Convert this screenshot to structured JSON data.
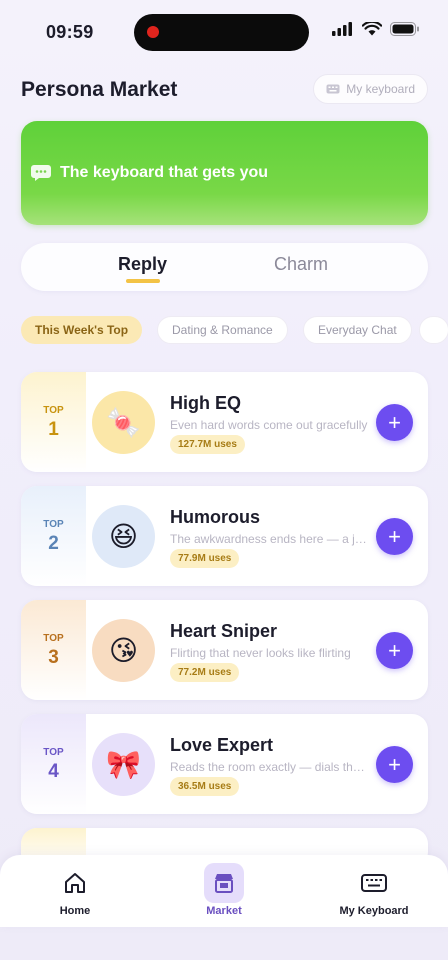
{
  "status_bar": {
    "time": "09:59"
  },
  "header": {
    "title": "Persona Market",
    "my_keyboard_label": "My keyboard"
  },
  "banner": {
    "text": "The keyboard that gets you"
  },
  "segments": {
    "reply": "Reply",
    "charm": "Charm",
    "active": "Reply"
  },
  "chips": {
    "items": [
      "This Week's Top",
      "Dating & Romance",
      "Everyday Chat"
    ],
    "active": "This Week's Top"
  },
  "cards": [
    {
      "rank_label": "TOP",
      "rank": "1",
      "title": "High EQ",
      "desc": "Even hard words come out gracefully",
      "uses": "127.7M uses",
      "rank_color": "#c8930f",
      "rank_bg": "#fdf3cf",
      "avatar_bg": "#fbe7a8",
      "avatar_emoji": "🍬",
      "avatar_icon": "candy-icon"
    },
    {
      "rank_label": "TOP",
      "rank": "2",
      "title": "Humorous",
      "desc": "The awkwardness ends here — a joke for every moment",
      "uses": "77.9M uses",
      "rank_color": "#5a84b6",
      "rank_bg": "#e8f0fb",
      "avatar_bg": "#dfe9f8",
      "avatar_emoji": "😆",
      "avatar_icon": "laughing-face-icon"
    },
    {
      "rank_label": "TOP",
      "rank": "3",
      "title": "Heart Sniper",
      "desc": "Flirting that never looks like flirting",
      "uses": "77.2M uses",
      "rank_color": "#b8701e",
      "rank_bg": "#fbe9d4",
      "avatar_bg": "#f8dcc1",
      "avatar_emoji": "😘",
      "avatar_icon": "kissing-face-icon"
    },
    {
      "rank_label": "TOP",
      "rank": "4",
      "title": "Love Expert",
      "desc": "Reads the room exactly — dials the tone",
      "uses": "36.5M uses",
      "rank_color": "#6a56c6",
      "rank_bg": "#ece7fb",
      "avatar_bg": "#e7e0fa",
      "avatar_emoji": "🎀",
      "avatar_icon": "ribbon-icon"
    }
  ],
  "tabbar": {
    "home": "Home",
    "market": "Market",
    "keyboard": "My Keyboard",
    "active": "Market"
  },
  "colors": {
    "accent": "#6d4df0",
    "banner_green": "#6bd43f",
    "chip_active_bg": "#fbe9b5",
    "uses_badge_bg": "#fcefc4"
  }
}
